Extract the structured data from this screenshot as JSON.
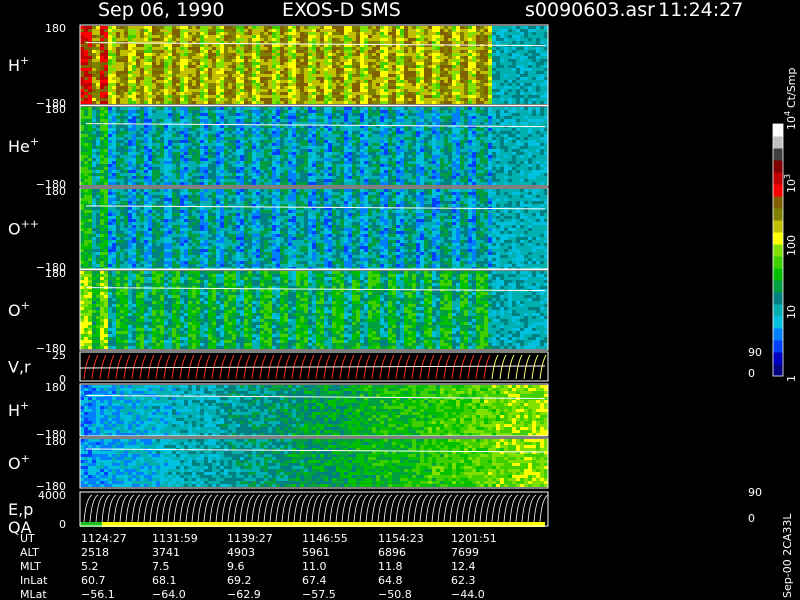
{
  "title": {
    "date": "Sep 06, 1990",
    "instrument": "EXOS-D SMS",
    "file": "s0090603.asr",
    "time": "11:24:27"
  },
  "colorbar": {
    "unit": "Ct/Smp",
    "tick_labels": [
      "1",
      "10",
      "100",
      "10",
      "10"
    ],
    "tick_exponents": [
      "",
      "",
      "",
      "3",
      "4"
    ],
    "tick_values": [
      1,
      10,
      100,
      1000,
      10000
    ],
    "colors": [
      "#000080",
      "#0000c0",
      "#0040ff",
      "#0080ff",
      "#00c0e0",
      "#00b0b0",
      "#008080",
      "#00a040",
      "#00c000",
      "#40d000",
      "#80e000",
      "#ffff00",
      "#c0c000",
      "#808000",
      "#806000",
      "#ff0000",
      "#c00000",
      "#800000",
      "#404040",
      "#c0c0c0",
      "#ffffff"
    ]
  },
  "panels": [
    {
      "label": "H",
      "charge": "+",
      "ymax": "180",
      "ymin": "−180"
    },
    {
      "label": "He",
      "charge": "+",
      "ymax": "180",
      "ymin": "−180"
    },
    {
      "label": "O",
      "charge": "++",
      "ymax": "180",
      "ymin": "−180"
    },
    {
      "label": "O",
      "charge": "+",
      "ymax": "180",
      "ymin": "−180"
    },
    {
      "label": "V,r",
      "charge": "",
      "ymax": "25",
      "ymin": "0",
      "rmax": "90",
      "rmin": "0"
    },
    {
      "label": "H",
      "charge": "+",
      "ymax": "180",
      "ymin": "−180"
    },
    {
      "label": "O",
      "charge": "+",
      "ymax": "180",
      "ymin": "−180"
    },
    {
      "label": "E,p",
      "label2": "QA",
      "charge": "",
      "ymax": "4000",
      "ymin": "0",
      "rmax": "90",
      "rmin": "0"
    }
  ],
  "ephemeris": {
    "labels": [
      "UT",
      "ALT",
      "MLT",
      "InLat",
      "MLat"
    ],
    "columns": [
      [
        "1124:27",
        "2518",
        "5.2",
        "60.7",
        "−56.1"
      ],
      [
        "1131:59",
        "3741",
        "7.5",
        "68.1",
        "−64.0"
      ],
      [
        "1139:27",
        "4903",
        "9.6",
        "69.2",
        "−62.9"
      ],
      [
        "1146:55",
        "5961",
        "11.0",
        "67.4",
        "−57.5"
      ],
      [
        "1154:23",
        "6896",
        "11.8",
        "64.8",
        "−50.8"
      ],
      [
        "1201:51",
        "7699",
        "12.4",
        "62.3",
        "−44.0"
      ]
    ]
  },
  "side_label": "Sep-00 2CA33L",
  "chart_data": {
    "type": "heatmap",
    "x_label": "UT",
    "x_ticks": [
      "1124:27",
      "1131:59",
      "1139:27",
      "1146:55",
      "1154:23",
      "1201:51"
    ],
    "panels": [
      "H+",
      "He+",
      "O++",
      "O+",
      "V,r",
      "H+",
      "O+",
      "E,p"
    ],
    "pitch_angle_range": [
      -180,
      180
    ],
    "color_scale": "log",
    "color_range": [
      1,
      10000
    ],
    "color_unit": "Ct/Smp"
  }
}
